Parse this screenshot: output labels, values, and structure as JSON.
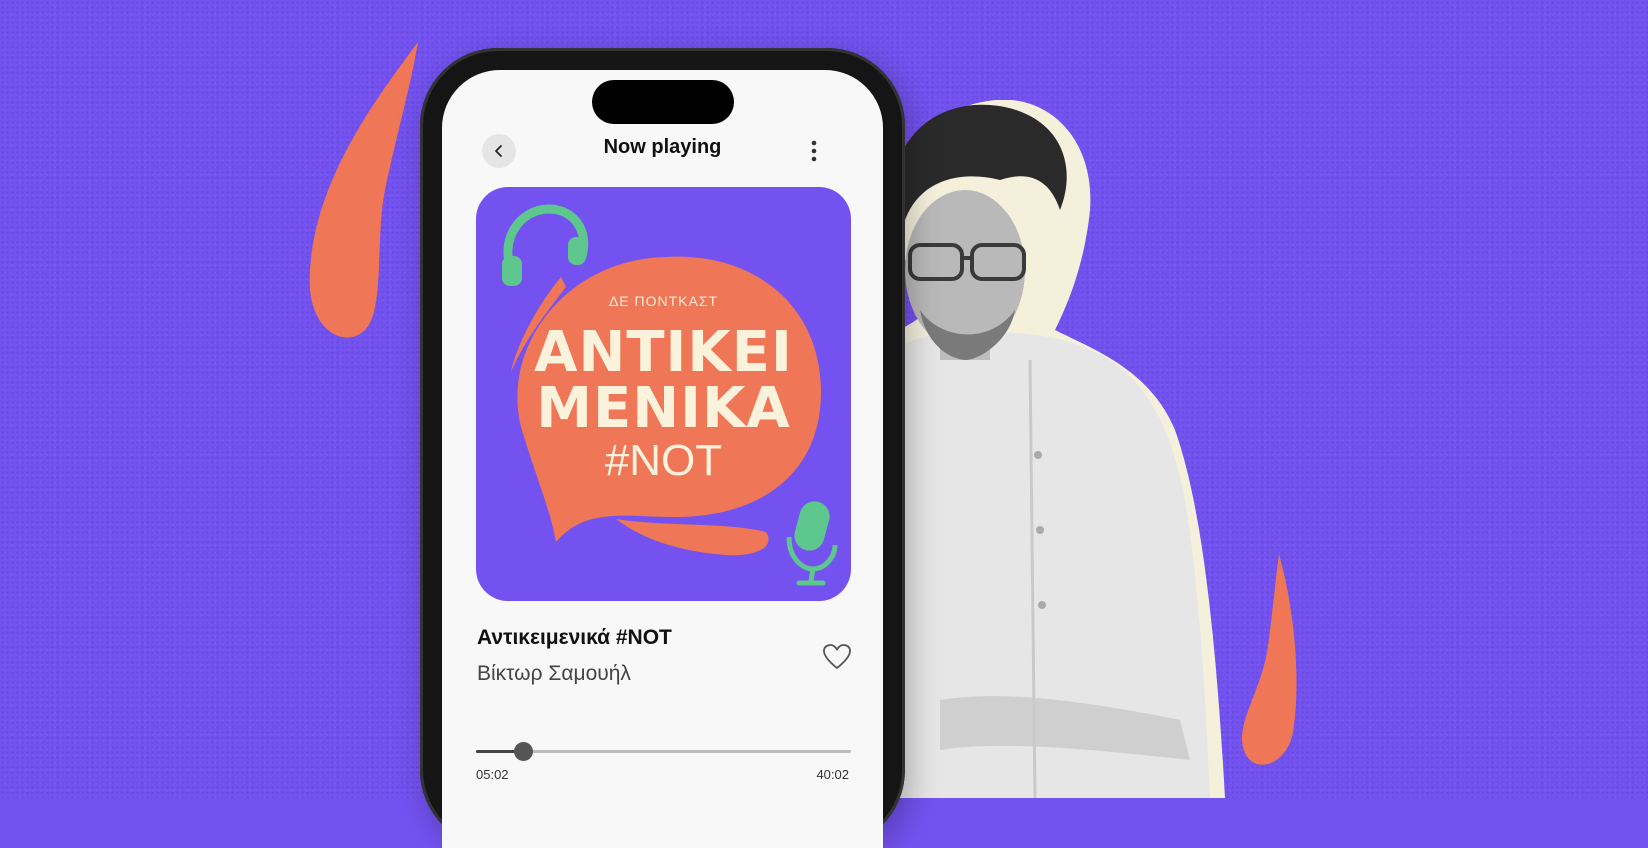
{
  "header": {
    "title": "Now playing",
    "back_icon": "chevron-left-icon",
    "more_icon": "more-vertical-icon"
  },
  "cover": {
    "kicker": "ΔΕ ΠΟΝΤΚΑΣΤ",
    "line1": "ANTIKEI",
    "line2": "MENIKA",
    "hashtag": "#NOT",
    "icons": [
      "headphones-icon",
      "microphone-icon"
    ]
  },
  "track": {
    "title": "Αντικειμενικά #NOT",
    "artist": "Βίκτωρ Σαμουήλ",
    "like_icon": "heart-icon"
  },
  "progress": {
    "elapsed": "05:02",
    "total": "40:02",
    "fraction": 0.125
  },
  "colors": {
    "background": "#7352f0",
    "accent_orange": "#ef7657",
    "accent_green": "#5dc78d",
    "cream": "#fbf2dc"
  }
}
